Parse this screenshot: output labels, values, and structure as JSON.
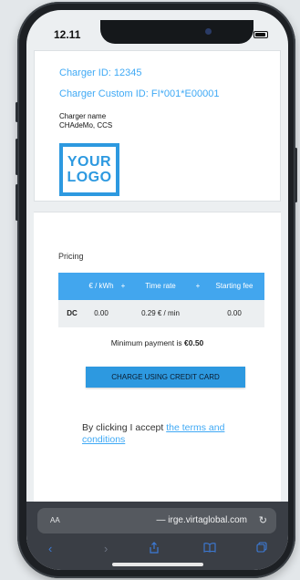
{
  "status": {
    "time": "12.11"
  },
  "charger": {
    "id": "Charger ID: 12345",
    "custom_id": "Charger Custom ID: FI*001*E00001",
    "name_label": "Charger name",
    "name_value": "CHAdeMo, CCS"
  },
  "logo": {
    "line1": "YOUR",
    "line2": "LOGO"
  },
  "pricing": {
    "label": "Pricing",
    "headers": {
      "energy": "€ / kWh",
      "plus1": "+",
      "time_rate": "Time rate",
      "plus2": "+",
      "starting_fee": "Starting fee"
    },
    "row": {
      "type": "DC",
      "energy": "0.00",
      "time_rate": "0.29 € / min",
      "starting_fee": "0.00"
    },
    "min_payment_text": "Minimum payment is ",
    "min_payment_value": "€0.50"
  },
  "charge_button": "CHARGE USING CREDIT CARD",
  "terms": {
    "prefix": "By clicking I accept ",
    "link": "the terms and conditions"
  },
  "browser": {
    "aa_label": "AA",
    "url": "— irge.virtaglobal.com",
    "reload_icon": "reload-icon"
  },
  "colors": {
    "accent": "#2d99e0",
    "link": "#3fa9f5",
    "table_header": "#42a6ee"
  }
}
